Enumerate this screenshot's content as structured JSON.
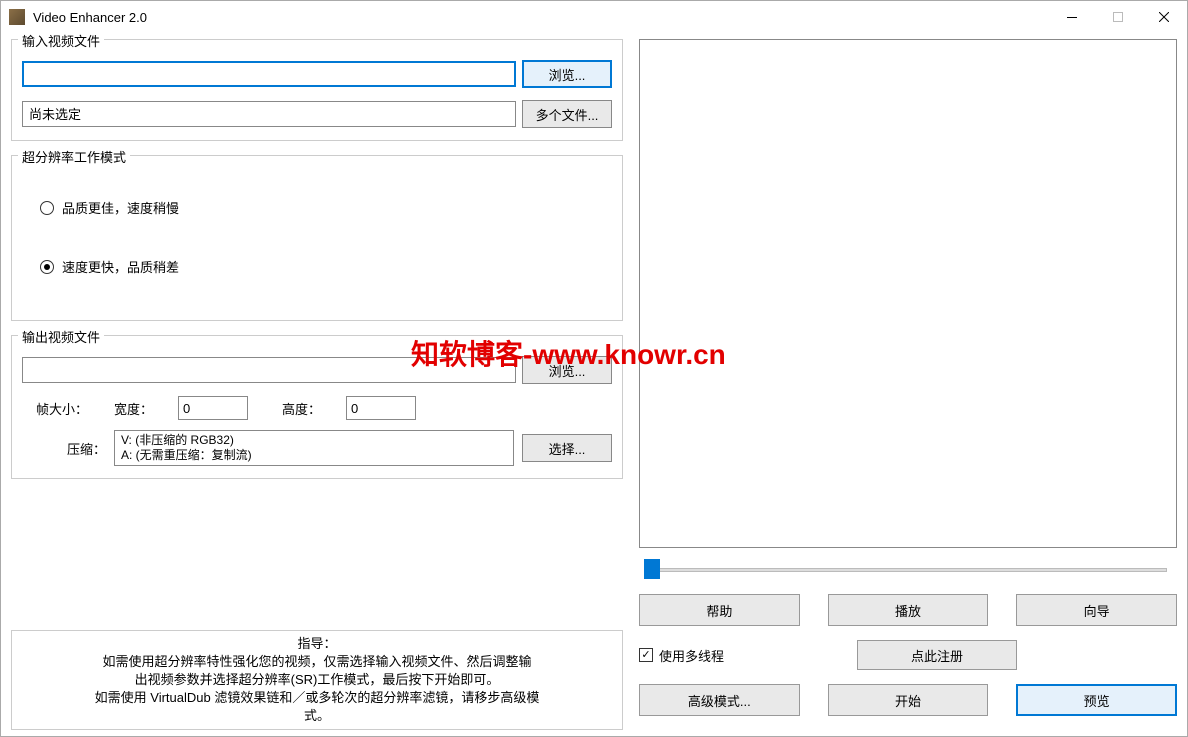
{
  "window": {
    "title": "Video Enhancer 2.0"
  },
  "input_group": {
    "title": "输入视频文件",
    "browse_btn": "浏览...",
    "status": "尚未选定",
    "multiple_btn": "多个文件..."
  },
  "mode_group": {
    "title": "超分辨率工作模式",
    "option1": "品质更佳，速度稍慢",
    "option2": "速度更快，品质稍差"
  },
  "output_group": {
    "title": "输出视频文件",
    "browse_btn": "浏览...",
    "frame_size": "帧大小：",
    "width_label": "宽度：",
    "width_value": "0",
    "height_label": "高度：",
    "height_value": "0",
    "compress_label": "压缩：",
    "compress_v": "V: (非压缩的 RGB32)",
    "compress_a": "A: (无需重压缩：复制流)",
    "select_btn": "选择..."
  },
  "guide": {
    "title": "指导：",
    "line1": "如需使用超分辨率特性强化您的视频，仅需选择输入视频文件、然后调整输",
    "line2": "出视频参数并选择超分辨率(SR)工作模式，最后按下开始即可。",
    "line3": "如需使用 VirtualDub 滤镜效果链和／或多轮次的超分辨率滤镜，请移步高级模",
    "line4": "式。"
  },
  "buttons": {
    "help": "帮助",
    "play": "播放",
    "wizard": "向导",
    "multithread": "使用多线程",
    "register": "点此注册",
    "advanced": "高级模式...",
    "start": "开始",
    "preview": "预览"
  },
  "watermark": "知软博客-www.knowr.cn"
}
